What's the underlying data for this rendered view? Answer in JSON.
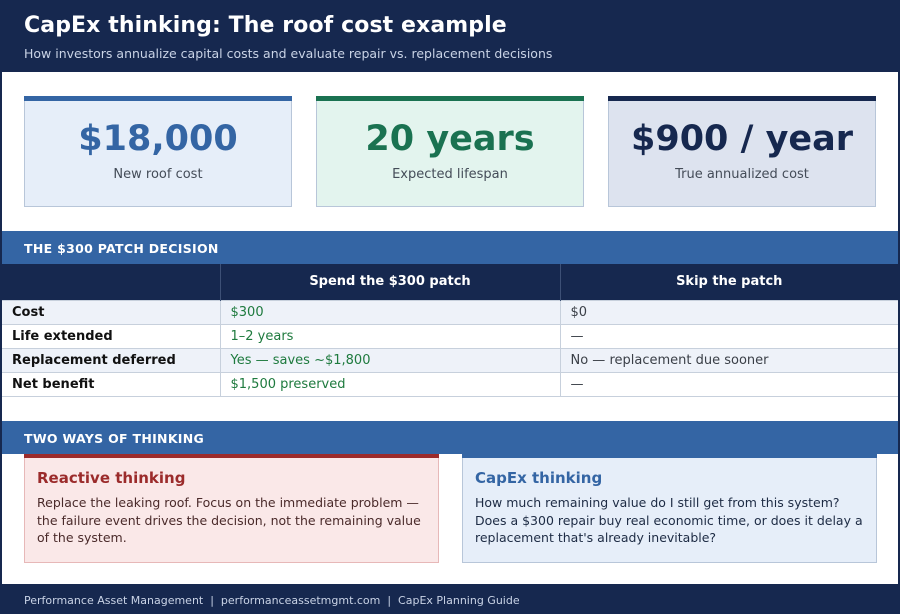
{
  "header": {
    "title": "CapEx thinking: The roof cost example",
    "subtitle": "How investors annualize capital costs and evaluate repair vs. replacement decisions"
  },
  "cards": [
    {
      "value": "$18,000",
      "label": "New roof cost"
    },
    {
      "value": "20 years",
      "label": "Expected lifespan"
    },
    {
      "value": "$900 / year",
      "label": "True annualized cost"
    }
  ],
  "patch_section": {
    "title": "THE $300 PATCH DECISION",
    "columns": [
      "",
      "Spend the $300 patch",
      "Skip the patch"
    ],
    "rows": [
      {
        "label": "Cost",
        "spend": "$300",
        "skip": "$0"
      },
      {
        "label": "Life extended",
        "spend": "1–2 years",
        "skip": "—"
      },
      {
        "label": "Replacement deferred",
        "spend": "Yes — saves ~$1,800",
        "skip": "No — replacement due sooner"
      },
      {
        "label": "Net benefit",
        "spend": "$1,500 preserved",
        "skip": "—"
      }
    ]
  },
  "thinking_section": {
    "title": "TWO WAYS OF THINKING",
    "reactive": {
      "heading": "Reactive thinking",
      "body": "Replace the leaking roof. Focus on the immediate problem — the failure event drives the decision, not the remaining value of the system."
    },
    "capex": {
      "heading": "CapEx thinking",
      "body": "How much remaining value do I still get from this system? Does a $300 repair buy real economic time, or does it delay a replacement that's already inevitable?"
    }
  },
  "footer": {
    "text": "Performance Asset Management  |  performanceassetmgmt.com  |  CapEx Planning Guide"
  },
  "colors": {
    "navy": "#16284f",
    "blue": "#3465a4",
    "green": "#1a7251",
    "red": "#9b2b2b"
  }
}
